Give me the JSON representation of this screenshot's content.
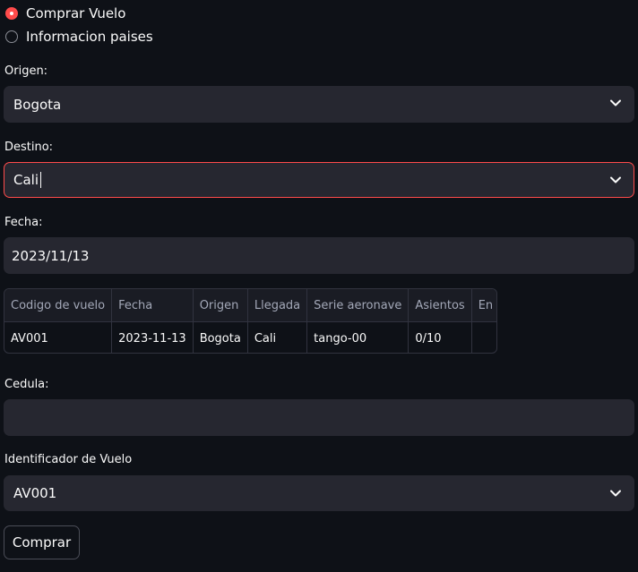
{
  "radio": {
    "options": [
      {
        "label": "Comprar Vuelo",
        "selected": true
      },
      {
        "label": "Informacion paises",
        "selected": false
      }
    ]
  },
  "origen": {
    "label": "Origen:",
    "value": "Bogota",
    "icon": "chevron-down-icon"
  },
  "destino": {
    "label": "Destino:",
    "value": "Cali",
    "icon": "chevron-down-icon"
  },
  "fecha": {
    "label": "Fecha:",
    "value": "2023/11/13"
  },
  "table": {
    "columns": [
      "Codigo de vuelo",
      "Fecha",
      "Origen",
      "Llegada",
      "Serie aeronave",
      "Asientos",
      "En el aire"
    ],
    "rows": [
      {
        "codigo": "AV001",
        "fecha": "2023-11-13",
        "origen": "Bogota",
        "llegada": "Cali",
        "serie": "tango-00",
        "asientos": "0/10",
        "en_el_aire": false
      }
    ]
  },
  "cedula": {
    "label": "Cedula:",
    "value": "",
    "placeholder": ""
  },
  "identificador": {
    "label": "Identificador de Vuelo",
    "value": "AV001",
    "icon": "chevron-down-icon"
  },
  "buttons": {
    "comprar": "Comprar"
  },
  "colors": {
    "background": "#0e1117",
    "field": "#262730",
    "accent": "#ff4b4b",
    "text": "#fafafa",
    "muted": "#a3a8b8"
  }
}
